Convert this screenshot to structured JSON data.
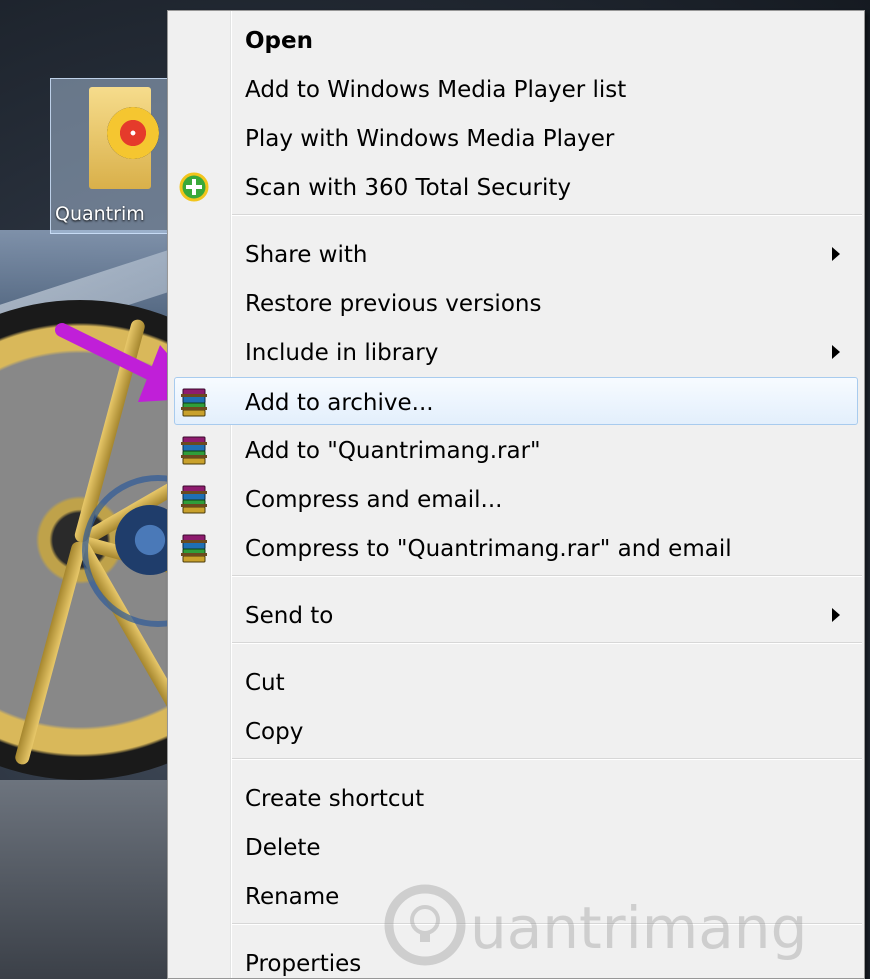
{
  "desktop": {
    "icon_label": "Quantrim"
  },
  "context_menu": {
    "groups": [
      [
        {
          "label": "Open",
          "bold": true,
          "icon": null,
          "submenu": false
        },
        {
          "label": "Add to Windows Media Player list",
          "icon": null,
          "submenu": false
        },
        {
          "label": "Play with Windows Media Player",
          "icon": null,
          "submenu": false
        },
        {
          "label": "Scan with 360 Total Security",
          "icon": "360-security-icon",
          "submenu": false
        }
      ],
      [
        {
          "label": "Share with",
          "icon": null,
          "submenu": true
        },
        {
          "label": "Restore previous versions",
          "icon": null,
          "submenu": false
        },
        {
          "label": "Include in library",
          "icon": null,
          "submenu": true
        },
        {
          "label": "Add to archive...",
          "icon": "winrar-icon",
          "submenu": false,
          "highlighted": true
        },
        {
          "label": "Add to \"Quantrimang.rar\"",
          "icon": "winrar-icon",
          "submenu": false
        },
        {
          "label": "Compress and email...",
          "icon": "winrar-icon",
          "submenu": false
        },
        {
          "label": "Compress to \"Quantrimang.rar\" and email",
          "icon": "winrar-icon",
          "submenu": false
        }
      ],
      [
        {
          "label": "Send to",
          "icon": null,
          "submenu": true
        }
      ],
      [
        {
          "label": "Cut",
          "icon": null,
          "submenu": false
        },
        {
          "label": "Copy",
          "icon": null,
          "submenu": false
        }
      ],
      [
        {
          "label": "Create shortcut",
          "icon": null,
          "submenu": false
        },
        {
          "label": "Delete",
          "icon": null,
          "submenu": false
        },
        {
          "label": "Rename",
          "icon": null,
          "submenu": false
        }
      ],
      [
        {
          "label": "Properties",
          "icon": null,
          "submenu": false
        }
      ]
    ]
  },
  "watermark": {
    "text": "uantrimang"
  },
  "colors": {
    "menu_bg": "#f0f0f0",
    "highlight_border": "#a8cbee",
    "arrow": "#c01fd8"
  }
}
